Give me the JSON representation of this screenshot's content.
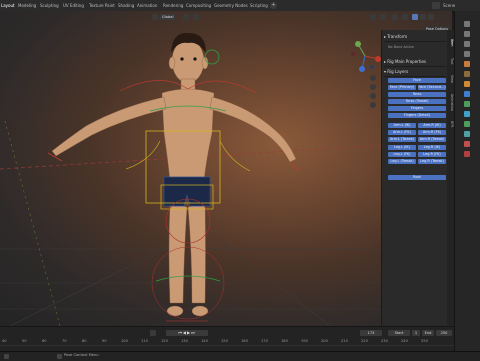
{
  "topbar": {
    "tabs": [
      "Layout",
      "Modeling",
      "Sculpting",
      "UV Editing",
      "Texture Paint",
      "Shading",
      "Animation",
      "Rendering",
      "Compositing",
      "Geometry Nodes",
      "Scripting"
    ],
    "active_tab": "Layout",
    "scene_label": "Scene"
  },
  "viewport": {
    "orientation_dropdown": "Global",
    "pose_options": "Pose Options"
  },
  "npanel": {
    "transform": "Transform",
    "no_bone_active": "No Bone Active",
    "rig_main_properties": "Rig Main Properties",
    "rig_layers": "Rig Layers",
    "buttons": [
      [
        "Face"
      ],
      [
        "Face (Primary)",
        "Face (Second...)"
      ],
      [
        "Torso"
      ],
      [
        "Torso (Tweak)"
      ],
      [
        "Fingers"
      ],
      [
        "Fingers (Detail)"
      ],
      [
        "Arm.L (IK)",
        "Arm.R (IK)"
      ],
      [
        "Arm.L (FK)",
        "Arm.R (FK)"
      ],
      [
        "Arm.L (Tweak)",
        "Arm.R (Tweak)"
      ],
      [
        "Leg.L (IK)",
        "Leg.R (IK)"
      ],
      [
        "Leg.L (FK)",
        "Leg.R (FK)"
      ],
      [
        "Leg.L (Tweak)",
        "Leg.R (Tweak)"
      ],
      [
        "Root"
      ]
    ],
    "side_tabs": [
      "Item",
      "Tool",
      "View",
      "Animation",
      "BFR"
    ]
  },
  "timeline": {
    "frames": [
      "40",
      "50",
      "60",
      "70",
      "80",
      "90",
      "100",
      "110",
      "120",
      "130",
      "140",
      "150",
      "160",
      "170",
      "180",
      "190",
      "200",
      "210",
      "220",
      "230",
      "240",
      "250"
    ],
    "frame_range_start_field": "Start",
    "start_value": "1",
    "end_label": "End",
    "end_value": "250",
    "current_frame": "173"
  },
  "statusbar": {
    "left": "Pose Context Menu"
  }
}
